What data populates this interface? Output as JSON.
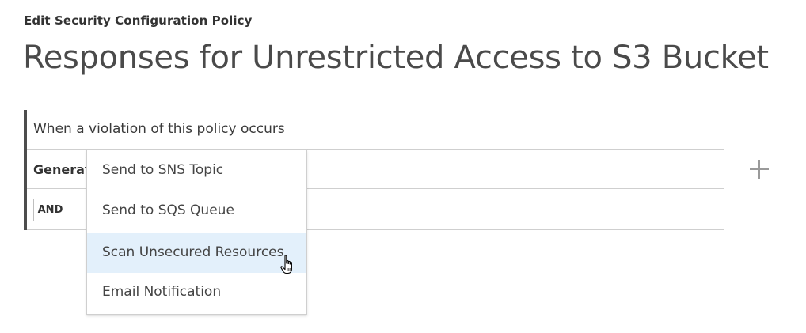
{
  "breadcrumb": "Edit Security Configuration Policy",
  "title": "Responses for Unrestricted Access to S3 Bucket",
  "panel": {
    "heading": "When a violation of this policy occurs",
    "row_label": "Generat",
    "and_label": "AND"
  },
  "dropdown": {
    "items": [
      {
        "label": "Send to SNS Topic"
      },
      {
        "label": "Send to SQS Queue"
      },
      {
        "label": "Scan Unsecured Resources",
        "hovered": true
      },
      {
        "label": "Email Notification"
      }
    ]
  },
  "icons": {
    "add": "plus-icon",
    "cursor": "hand-pointer-icon"
  },
  "colors": {
    "hover_bg": "#e3f0fb",
    "accent_bar": "#4d4d4d",
    "divider": "#cfcfcf"
  }
}
